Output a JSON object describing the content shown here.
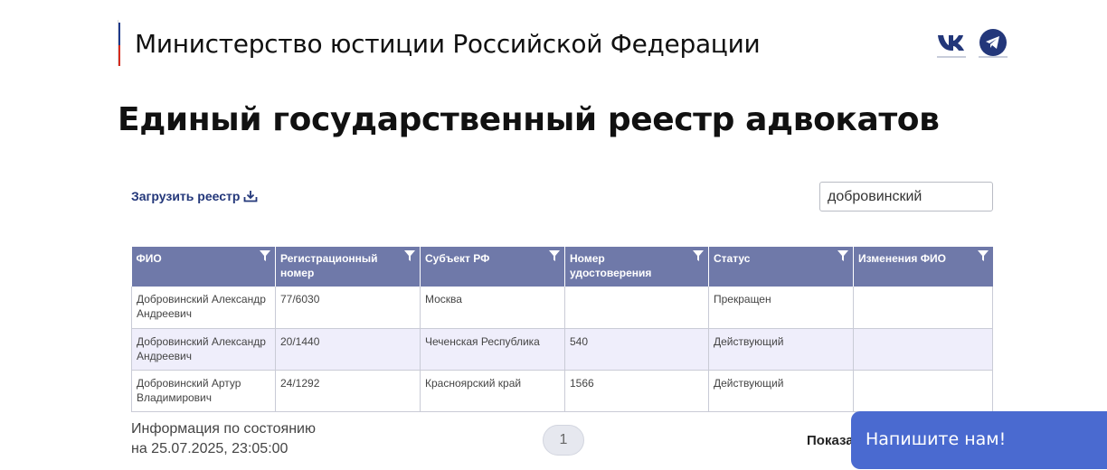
{
  "header": {
    "org_name": "Министерство юстиции Российской Федерации",
    "social": [
      {
        "icon": "vk-icon"
      },
      {
        "icon": "telegram-icon"
      }
    ]
  },
  "page": {
    "title": "Единый государственный реестр адвокатов"
  },
  "toolbar": {
    "download_label": "Загрузить реестр",
    "search_value": "добровинский"
  },
  "table": {
    "columns": [
      "ФИО",
      "Регистрационный номер",
      "Субъект РФ",
      "Номер удостоверения",
      "Статус",
      "Изменения ФИО"
    ],
    "rows": [
      [
        "Добровинский Александр Андреевич",
        "77/6030",
        "Москва",
        "",
        "Прекращен",
        ""
      ],
      [
        "Добровинский Александр Андреевич",
        "20/1440",
        "Чеченская Республика",
        "540",
        "Действующий",
        ""
      ],
      [
        "Добровинский Артур Владимирович",
        "24/1292",
        "Красноярский край",
        "1566",
        "Действующий",
        ""
      ]
    ]
  },
  "footer": {
    "info_line1": "Информация по состоянию",
    "info_line2": "на 25.07.2025, 23:05:00",
    "page_number": "1",
    "show_label": "Показа"
  },
  "chat": {
    "label": "Напишите нам!"
  },
  "colors": {
    "header_bg": "#6f79a9",
    "alt_row_bg": "#efeefb",
    "accent": "#23377a",
    "chat_bg": "#4a6ad0"
  }
}
